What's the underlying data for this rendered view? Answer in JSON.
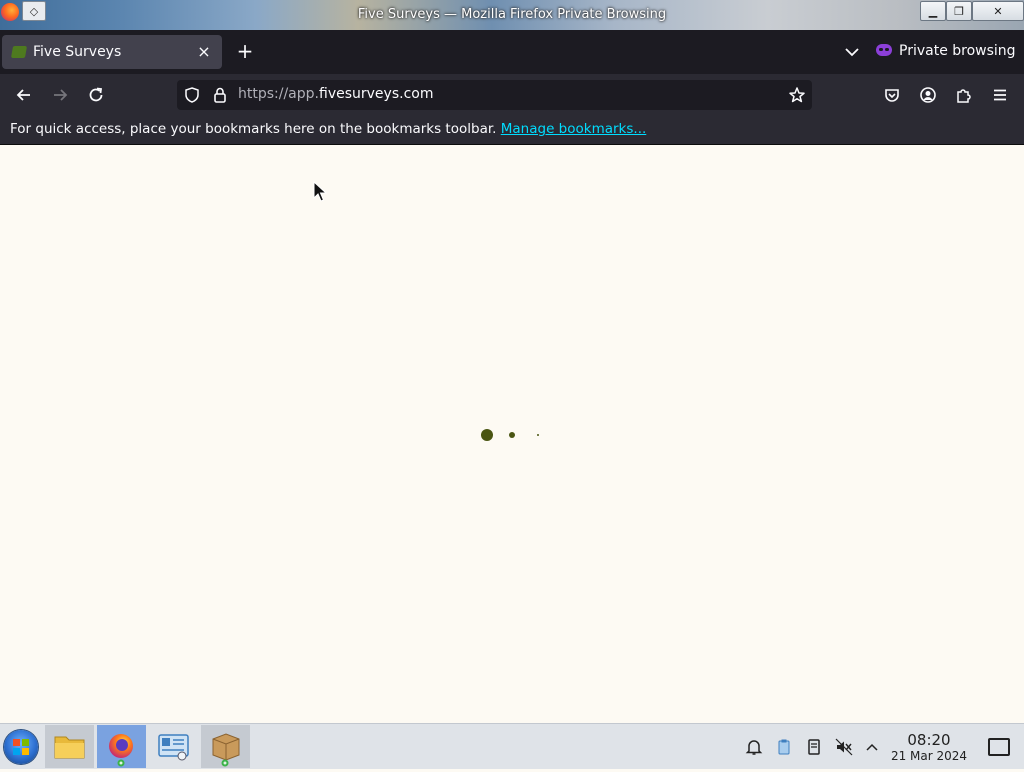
{
  "window": {
    "title": "Five Surveys — Mozilla Firefox Private Browsing"
  },
  "tabs": [
    {
      "label": "Five Surveys",
      "active": true
    }
  ],
  "private_label": "Private browsing",
  "urlbar": {
    "prefix": "https://app.",
    "domain": "fivesurveys.com"
  },
  "bookmarks_toolbar": {
    "message": "For quick access, place your bookmarks here on the bookmarks toolbar.",
    "link_label": "Manage bookmarks..."
  },
  "content": {
    "state": "loading",
    "loader_color": "#4a5512",
    "background": "#fdfaf3"
  },
  "taskbar": {
    "apps": [
      {
        "name": "file-manager-icon"
      },
      {
        "name": "firefox-icon",
        "active": true
      },
      {
        "name": "system-settings-icon"
      },
      {
        "name": "package-installer-icon"
      }
    ],
    "tray_icons": [
      "notifications-icon",
      "clipboard-icon",
      "storage-icon",
      "volume-muted-icon",
      "tray-expand-icon"
    ],
    "clock": {
      "time": "08:20",
      "date": "21 Mar 2024"
    }
  },
  "colors": {
    "toolbar": "#2b2a33",
    "tabstrip": "#1c1b22",
    "link": "#00ddff",
    "private_mask": "#8c3fd9"
  }
}
